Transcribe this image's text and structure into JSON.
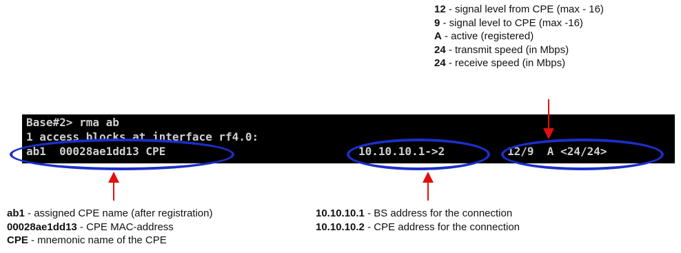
{
  "top_legend": [
    {
      "key": "12",
      "text": " - signal level from CPE (max - 16)"
    },
    {
      "key": "9",
      "text": " - signal level to CPE (max -16)"
    },
    {
      "key": "A",
      "text": " - active (registered)"
    },
    {
      "key": "24",
      "text": " - transmit speed (in Mbps)"
    },
    {
      "key": "24",
      "text": " - receive speed (in Mbps)"
    }
  ],
  "terminal": {
    "line1": "Base#2> rma ab",
    "line2": "1 access blocks at interface rf4.0:",
    "name_mac": "ab1  00028ae1dd13 CPE",
    "address": "10.10.10.1->2",
    "stats": "12/9  A <24/24>"
  },
  "left_legend": [
    {
      "key": "ab1",
      "text": " - assigned CPE name (after registration)"
    },
    {
      "key": "00028ae1dd13",
      "text": " - CPE MAC-address"
    },
    {
      "key": "CPE",
      "text": " - mnemonic name of the CPE"
    }
  ],
  "mid_legend": [
    {
      "key": "10.10.10.1",
      "text": " - BS address for the connection"
    },
    {
      "key": "10.10.10.2",
      "text": " - CPE address for the connection"
    }
  ],
  "colors": {
    "ellipse": "#1b2fc9",
    "arrow": "#e01010",
    "terminal_bg": "#000000",
    "terminal_text": "#d0d0d0"
  }
}
